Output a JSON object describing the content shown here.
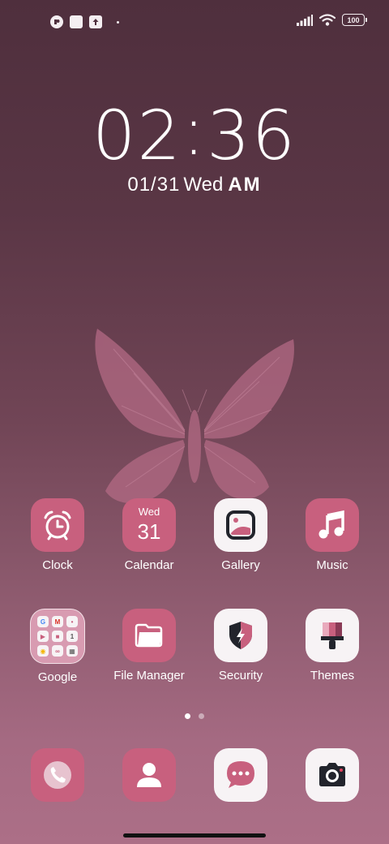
{
  "status": {
    "left_icons": [
      "app-notification-icon",
      "square-notification-icon",
      "upload-notification-icon",
      "dot-icon"
    ],
    "right_icons": [
      "signal-icon",
      "wifi-icon",
      "battery-icon"
    ],
    "battery": "100"
  },
  "clock": {
    "hours": "02",
    "colon": ":",
    "minutes": "36",
    "date": "01/31",
    "weekday": "Wed",
    "ampm": "AM"
  },
  "apps": {
    "clock": {
      "label": "Clock",
      "icon": "alarm-clock-icon"
    },
    "calendar": {
      "label": "Calendar",
      "icon": "calendar-icon",
      "day": "Wed",
      "date": "31"
    },
    "gallery": {
      "label": "Gallery",
      "icon": "gallery-icon"
    },
    "music": {
      "label": "Music",
      "icon": "music-note-icon"
    },
    "google": {
      "label": "Google",
      "icon": "folder-icon",
      "minis": [
        "G",
        "M",
        "•",
        "▶",
        "■",
        "1",
        "◉",
        "∞",
        "▦"
      ]
    },
    "file_manager": {
      "label": "File Manager",
      "icon": "folder-open-icon"
    },
    "security": {
      "label": "Security",
      "icon": "shield-bolt-icon"
    },
    "themes": {
      "label": "Themes",
      "icon": "paintbrush-icon"
    }
  },
  "pager": {
    "current": 1,
    "total": 2
  },
  "dock": [
    "phone-icon",
    "contacts-icon",
    "messages-icon",
    "camera-icon"
  ],
  "colors": {
    "accent": "#c8607e",
    "tile_white": "#f7f3f5",
    "dark": "#22242c"
  }
}
